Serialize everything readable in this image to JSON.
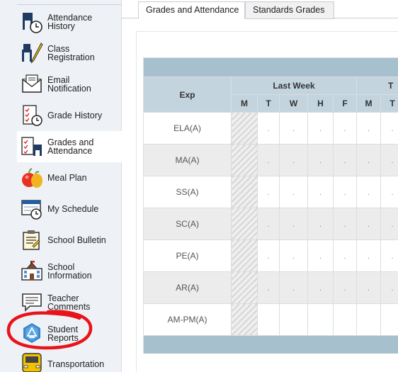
{
  "sidebar": {
    "items": [
      {
        "label": "Attendance\nHistory",
        "icon": "attendance-history-icon"
      },
      {
        "label": "Class\nRegistration",
        "icon": "class-registration-icon"
      },
      {
        "label": "Email\nNotification",
        "icon": "email-icon"
      },
      {
        "label": "Grade History",
        "icon": "grade-history-icon"
      },
      {
        "label": "Grades and\nAttendance",
        "icon": "grades-attendance-icon",
        "active": true
      },
      {
        "label": "Meal Plan",
        "icon": "meal-plan-icon"
      },
      {
        "label": "My Schedule",
        "icon": "schedule-icon"
      },
      {
        "label": "School Bulletin",
        "icon": "bulletin-icon"
      },
      {
        "label": "School\nInformation",
        "icon": "school-building-icon"
      },
      {
        "label": "Teacher\nComments",
        "icon": "comment-icon"
      },
      {
        "label": "Student\nReports",
        "icon": "student-reports-icon",
        "circled": true
      },
      {
        "label": "Transportation",
        "icon": "bus-icon"
      }
    ]
  },
  "tabs": [
    {
      "label": "Grades and Attendance",
      "active": true
    },
    {
      "label": "Standards Grades",
      "active": false
    }
  ],
  "table": {
    "exp_header": "Exp",
    "week_header": "Last Week",
    "next_week_fragment": "T",
    "days": [
      "M",
      "T",
      "W",
      "H",
      "F",
      "M",
      "T"
    ],
    "courses": [
      "ELA(A)",
      "MA(A)",
      "SS(A)",
      "SC(A)",
      "PE(A)",
      "AR(A)",
      "AM-PM(A)"
    ],
    "placeholder": "."
  },
  "colors": {
    "header_band": "#a7c0ce",
    "header_cells": "#c3d4df",
    "annotation_circle": "#e8141b"
  }
}
